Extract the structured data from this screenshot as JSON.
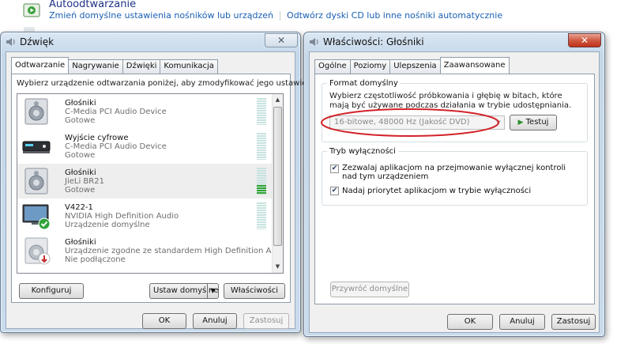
{
  "control_panel": {
    "title": "Autoodtwarzanie",
    "link1": "Zmień domyślne ustawienia nośników lub urządzeń",
    "link2": "Odtwórz dyski CD lub inne nośniki automatycznie"
  },
  "sound_dialog": {
    "title": "Dźwięk",
    "close": "✕",
    "tabs": [
      "Odtwarzanie",
      "Nagrywanie",
      "Dźwięki",
      "Komunikacja"
    ],
    "instruction": "Wybierz urządzenie odtwarzania poniżej, aby zmodyfikować jego ustawienia:",
    "devices": [
      {
        "name": "Głośniki",
        "desc": "C-Media PCI Audio Device",
        "status": "Gotowe",
        "icon": "speaker-icon",
        "selected": false
      },
      {
        "name": "Wyjście cyfrowe",
        "desc": "C-Media PCI Audio Device",
        "status": "Gotowe",
        "icon": "digital-output-icon",
        "selected": false
      },
      {
        "name": "Głośniki",
        "desc": "JieLi BR21",
        "status": "Gotowe",
        "icon": "speaker-icon",
        "selected": true
      },
      {
        "name": "V422-1",
        "desc": "NVIDIA High Definition Audio",
        "status": "Urządzenie domyślne",
        "icon": "monitor-default-icon",
        "selected": false
      },
      {
        "name": "Głośniki",
        "desc": "Urządzenie zgodne ze standardem High Definition Aud...",
        "status": "Nie podłączone",
        "icon": "speaker-disconnected-icon",
        "selected": false
      }
    ],
    "buttons": {
      "configure": "Konfiguruj",
      "set_default": "Ustaw domyślne",
      "properties": "Właściwości",
      "ok": "OK",
      "cancel": "Anuluj",
      "apply": "Zastosuj"
    }
  },
  "props_dialog": {
    "title": "Właściwości: Głośniki",
    "close": "✕",
    "tabs": [
      "Ogólne",
      "Poziomy",
      "Ulepszenia",
      "Zaawansowane"
    ],
    "default_format": {
      "legend": "Format domyślny",
      "description": "Wybierz częstotliwość próbkowania i głębię w bitach, które mają być używane podczas działania w trybie udostępniania.",
      "selected": "16-bitowe, 48000 Hz (Jakość DVD)",
      "test_button": "Testuj",
      "highlight_color": "#d2232a"
    },
    "exclusive_mode": {
      "legend": "Tryb wyłączności",
      "option1": "Zezwalaj aplikacjom na przejmowanie wyłącznej kontroli nad tym urządzeniem",
      "option1_checked": true,
      "option2": "Nadaj priorytet aplikacjom w trybie wyłączności",
      "option2_checked": true
    },
    "buttons": {
      "restore_defaults": "Przywróć domyślne",
      "ok": "OK",
      "cancel": "Anuluj",
      "apply": "Zastosuj"
    }
  }
}
